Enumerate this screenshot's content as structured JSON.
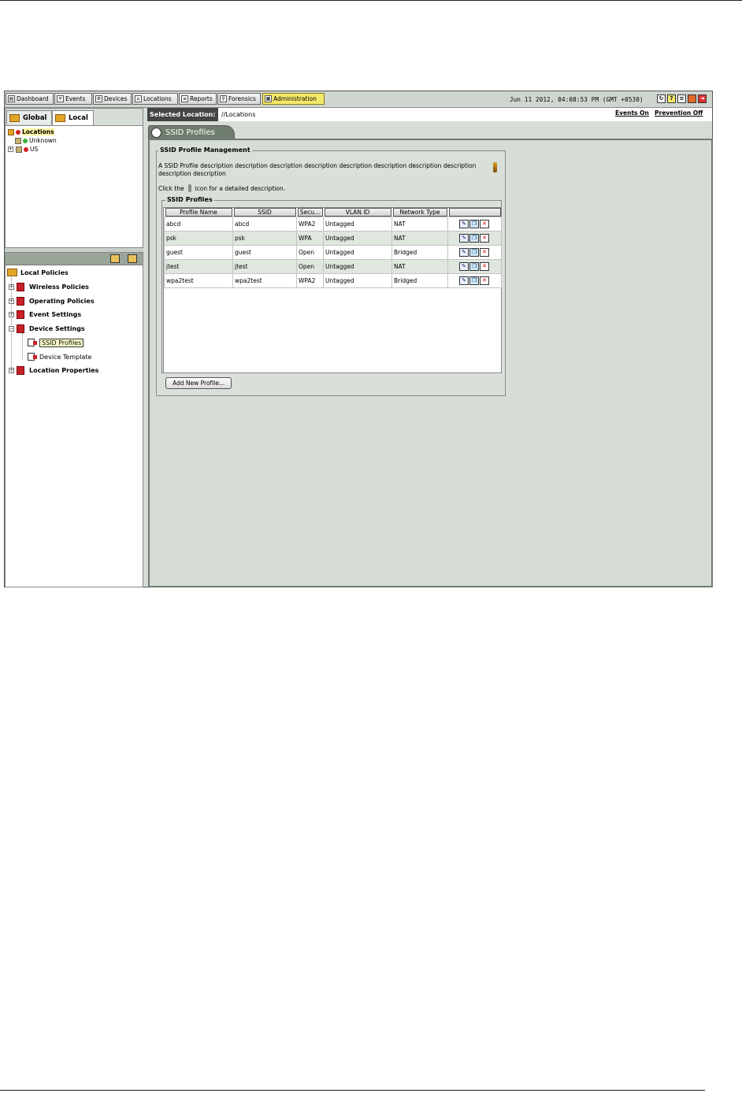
{
  "toolbar": {
    "buttons": [
      {
        "label": "Dashboard",
        "icon": "dashboard-icon"
      },
      {
        "label": "Events",
        "icon": "events-icon"
      },
      {
        "label": "Devices",
        "icon": "devices-icon"
      },
      {
        "label": "Locations",
        "icon": "locations-icon"
      },
      {
        "label": "Reports",
        "icon": "reports-icon"
      },
      {
        "label": "Forensics",
        "icon": "forensics-icon"
      },
      {
        "label": "Administration",
        "icon": "administration-icon",
        "active": true
      }
    ],
    "datetime": "Jun 11 2012, 04:08:53 PM (GMT +0530)",
    "right_icons": [
      "refresh-icon",
      "help-icon",
      "list-icon",
      "shield-icon",
      "logout-icon"
    ]
  },
  "scope_tabs": [
    {
      "label": "Global"
    },
    {
      "label": "Local",
      "active": true
    }
  ],
  "location_tree": [
    {
      "label": "Locations",
      "level": 0,
      "selected": true
    },
    {
      "label": "Unknown",
      "level": 1
    },
    {
      "label": "US",
      "level": 1
    }
  ],
  "policy_tree": {
    "root": "Local Policies",
    "items": [
      {
        "label": "Wireless Policies"
      },
      {
        "label": "Operating Policies"
      },
      {
        "label": "Event Settings"
      },
      {
        "label": "Device Settings",
        "expanded": true,
        "children": [
          {
            "label": "SSID Profiles",
            "selected": true
          },
          {
            "label": "Device Template"
          }
        ]
      },
      {
        "label": "Location Properties"
      }
    ]
  },
  "selected_location": {
    "label": "Selected Location:",
    "value": "//Locations"
  },
  "links": {
    "events": "Events On",
    "prevention": "Prevention Off"
  },
  "tab": {
    "label": "SSID Profiles"
  },
  "management": {
    "title": "SSID Profile Management",
    "description": "A SSID Profile description description description description description description description description description description",
    "click_prefix": "Click the",
    "click_suffix": "icon for a detailed description.",
    "profiles_title": "SSID Profiles",
    "columns": [
      "Profile Name",
      "SSID",
      "Secu...",
      "VLAN ID",
      "Network Type",
      ""
    ],
    "rows": [
      [
        "abcd",
        "abcd",
        "WPA2",
        "Untagged",
        "NAT"
      ],
      [
        "psk",
        "psk",
        "WPA",
        "Untagged",
        "NAT"
      ],
      [
        "guest",
        "guest",
        "Open",
        "Untagged",
        "Bridged"
      ],
      [
        "jtest",
        "jtest",
        "Open",
        "Untagged",
        "NAT"
      ],
      [
        "wpa2test",
        "wpa2test",
        "WPA2",
        "Untagged",
        "Bridged"
      ]
    ],
    "add_button": "Add New Profile..."
  }
}
